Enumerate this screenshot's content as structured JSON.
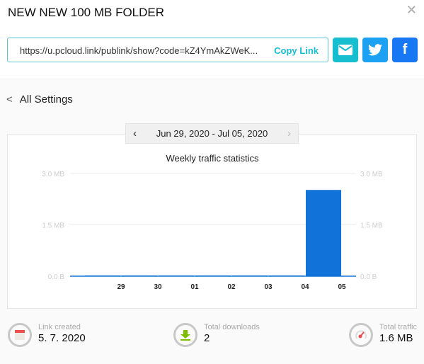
{
  "header": {
    "title": "NEW NEW 100 MB FOLDER",
    "close_icon": "close-icon"
  },
  "share": {
    "url": "https://u.pcloud.link/publink/show?code=kZ4YmAkZWeK...",
    "copy_label": "Copy Link",
    "buttons": [
      {
        "icon": "email-icon",
        "color": "#17bed0"
      },
      {
        "icon": "twitter-icon",
        "color": "#1da1f2"
      },
      {
        "icon": "facebook-icon",
        "color": "#1877f2"
      }
    ]
  },
  "nav": {
    "back_label": "All Settings",
    "date_range": "Jun 29, 2020 - Jul 05, 2020"
  },
  "chart_data": {
    "type": "bar",
    "title": "Weekly traffic statistics",
    "categories": [
      "29",
      "30",
      "01",
      "02",
      "03",
      "04",
      "05"
    ],
    "values": [
      0.02,
      0.02,
      0.02,
      0.02,
      0.02,
      0.02,
      2.52
    ],
    "unit": "MB",
    "ylim": [
      0,
      3.0
    ],
    "yticks": [
      "0.0 B",
      "1.5 MB",
      "3.0 MB"
    ],
    "color": "#1173d9",
    "grid": true,
    "right_axis": true
  },
  "stats": [
    {
      "label": "Link created",
      "value": "5. 7. 2020",
      "icon": "calendar-icon"
    },
    {
      "label": "Total downloads",
      "value": "2",
      "icon": "download-icon"
    },
    {
      "label": "Total traffic",
      "value": "1.6 MB",
      "icon": "gauge-icon"
    }
  ]
}
